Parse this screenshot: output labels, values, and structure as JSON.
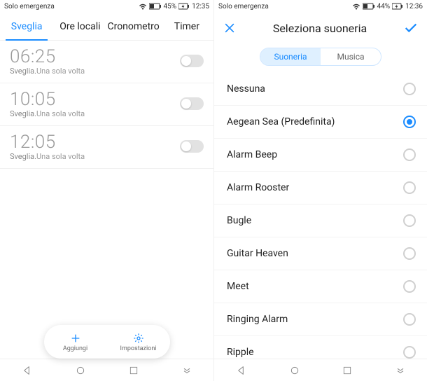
{
  "left": {
    "status": {
      "carrier": "Solo emergenza",
      "battery": "45%",
      "time": "12:35"
    },
    "tabs": [
      "Sveglia",
      "Ore locali",
      "Cronometro",
      "Timer"
    ],
    "active_tab": 0,
    "alarms": [
      {
        "time": "06:25",
        "label": "Sveglia.",
        "repeat": "Una sola volta"
      },
      {
        "time": "10:05",
        "label": "Sveglia.",
        "repeat": "Una sola volta"
      },
      {
        "time": "12:05",
        "label": "Sveglia.",
        "repeat": "Una sola volta"
      }
    ],
    "bottom": {
      "add": "Aggiungi",
      "settings": "Impostazioni"
    }
  },
  "right": {
    "status": {
      "carrier": "Solo emergenza",
      "battery": "44%",
      "time": "12:36"
    },
    "title": "Seleziona suoneria",
    "segments": [
      "Suoneria",
      "Musica"
    ],
    "active_segment": 0,
    "selected": 1,
    "ringtones": [
      "Nessuna",
      "Aegean Sea (Predefinita)",
      "Alarm Beep",
      "Alarm Rooster",
      "Bugle",
      "Guitar Heaven",
      "Meet",
      "Ringing Alarm",
      "Ripple"
    ]
  }
}
